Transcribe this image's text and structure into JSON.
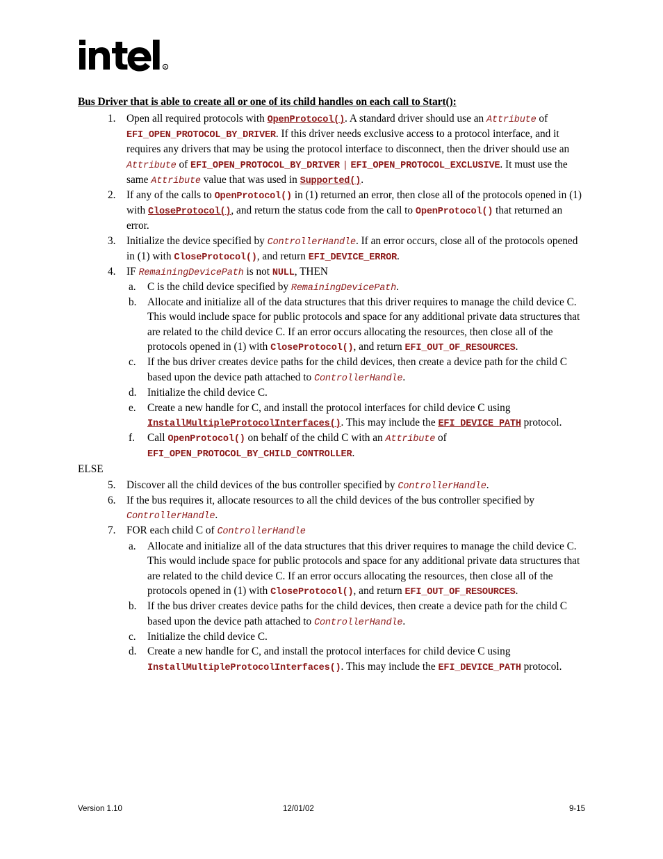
{
  "document": {
    "logo_alt": "intel",
    "heading": "Bus Driver that is able to create all or one of its child handles on each call to Start():",
    "else_keyword": "ELSE"
  },
  "colors": {
    "code_red": "#8C1A1A",
    "text_black": "#000000",
    "page_background": "#FFFFFF"
  },
  "markers": {
    "n1": "1.",
    "n2": "2.",
    "n3": "3.",
    "n4": "4.",
    "n5": "5.",
    "n6": "6.",
    "n7": "7.",
    "a": "a.",
    "b": "b.",
    "c": "c.",
    "d": "d.",
    "e": "e.",
    "f": "f."
  },
  "items": {
    "i1": {
      "t1": "Open all required protocols with ",
      "c1": "OpenProtocol()",
      "t2": ".  A standard driver should use an ",
      "c2": "Attribute",
      "t3": " of ",
      "c3": "EFI_OPEN_PROTOCOL_BY_DRIVER",
      "t4": ".  If this driver needs exclusive access to a protocol interface, and it requires any drivers that may be using the protocol interface to disconnect, then the driver should use an ",
      "c4": "Attribute",
      "t5": " of ",
      "c5": "EFI_OPEN_PROTOCOL_BY_DRIVER",
      "c6": "|",
      "c7": "EFI_OPEN_PROTOCOL_EXCLUSIVE",
      "t6": ".  It must use the same ",
      "c8": "Attribute",
      "t7": " value that was used in ",
      "c9": "Supported()",
      "t8": "."
    },
    "i2": {
      "t1": "If any of the calls to ",
      "c1": "OpenProtocol()",
      "t2": " in (1) returned an error, then close all of the protocols opened in (1) with ",
      "c2": "CloseProtocol()",
      "t3": ", and return the status code from the call to ",
      "c3": "OpenProtocol()",
      "t4": " that returned an error."
    },
    "i3": {
      "t1": "Initialize the device specified by ",
      "c1": "ControllerHandle",
      "t2": ".  If an error occurs, close all of the protocols opened in (1) with ",
      "c2": "CloseProtocol()",
      "t3": ", and return ",
      "c3": "EFI_DEVICE_ERROR",
      "t4": "."
    },
    "i4": {
      "t1": "IF ",
      "c1": "RemainingDevicePath",
      "t2": " is not ",
      "c2": "NULL",
      "t3": ", THEN"
    },
    "i4a": {
      "t1": "C is the child device specified by ",
      "c1": "RemainingDevicePath",
      "t2": "."
    },
    "i4b": {
      "t1": "Allocate and initialize all of the data structures that this driver requires to manage the child device C.  This would include space for public protocols and space for any additional private data structures that are related to the child device C.  If an error occurs allocating the resources, then close all of the protocols opened in (1) with ",
      "c1": "CloseProtocol()",
      "t2": ", and return ",
      "c2": "EFI_OUT_OF_RESOURCES",
      "t3": "."
    },
    "i4c": {
      "t1": "If the bus driver creates device paths for the child devices, then create a device path for the child C based upon the device path attached to ",
      "c1": "ControllerHandle",
      "t2": "."
    },
    "i4d": {
      "t1": "Initialize the child device C."
    },
    "i4e": {
      "t1": "Create a new handle for C, and install the protocol interfaces for child device C using ",
      "c1": "InstallMultipleProtocolInterfaces()",
      "t2": ".  This may include the ",
      "c2": "EFI_DEVICE_PATH",
      "t3": " protocol."
    },
    "i4f": {
      "t1": "Call ",
      "c1": "OpenProtocol()",
      "t2": " on behalf of the child C with an ",
      "c2": "Attribute",
      "t3": " of ",
      "c3": "EFI_OPEN_PROTOCOL_BY_CHILD_CONTROLLER",
      "t4": "."
    },
    "i5": {
      "t1": "Discover all the child devices of the bus controller specified by ",
      "c1": "ControllerHandle",
      "t2": "."
    },
    "i6": {
      "t1": "If the bus requires it, allocate resources to all the child devices of the bus controller specified by ",
      "c1": "ControllerHandle",
      "t2": "."
    },
    "i7": {
      "t1": "FOR each child C of ",
      "c1": "ControllerHandle"
    },
    "i7a": {
      "t1": "Allocate and initialize all of the data structures that this driver requires to manage the child device C.  This would include space for public protocols and space for any additional private data structures that are related to the child device C.  If an error occurs allocating the resources, then close all of the protocols opened in (1) with ",
      "c1": "CloseProtocol()",
      "t2": ", and return ",
      "c2": "EFI_OUT_OF_RESOURCES",
      "t3": "."
    },
    "i7b": {
      "t1": "If the bus driver creates device paths for the child devices, then create a device path for the child C based upon the device path attached to ",
      "c1": "ControllerHandle",
      "t2": "."
    },
    "i7c": {
      "t1": "Initialize the child device C."
    },
    "i7d": {
      "t1": "Create a new handle for C, and install the protocol interfaces for child device C using ",
      "c1": "InstallMultipleProtocolInterfaces()",
      "t2": ".  This may include the ",
      "c2": "EFI_DEVICE_PATH",
      "t3": " protocol."
    }
  },
  "footer": {
    "version": "Version 1.10",
    "date": "12/01/02",
    "page_number": "9-15"
  }
}
